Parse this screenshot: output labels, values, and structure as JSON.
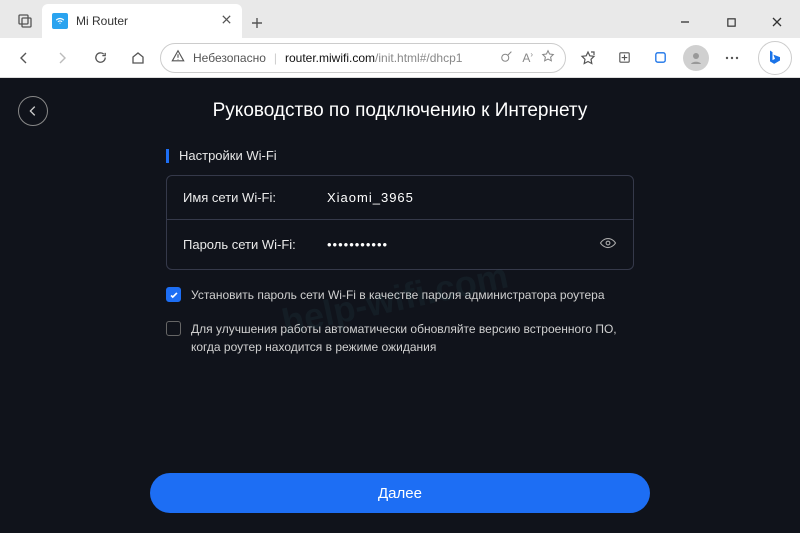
{
  "browser": {
    "tab_title": "Mi Router",
    "address": {
      "insecure_label": "Небезопасно",
      "host": "router.miwifi.com",
      "path": "/init.html#/dhcp1"
    }
  },
  "page": {
    "title": "Руководство по подключению к Интернету",
    "section_title": "Настройки Wi-Fi",
    "fields": {
      "ssid_label": "Имя сети Wi-Fi:",
      "ssid_value": "Xiaomi_3965",
      "password_label": "Пароль сети Wi-Fi:",
      "password_value": "•••••••••••"
    },
    "checkbox_admin": "Установить пароль сети Wi-Fi в качестве пароля администратора роутера",
    "checkbox_autoupdate": "Для улучшения работы автоматически обновляйте версию встроенного ПО, когда роутер находится в режиме ожидания",
    "button_next": "Далее"
  },
  "watermark": "help-wifi.com",
  "colors": {
    "accent": "#1d6ef4",
    "page_bg": "#10131b"
  }
}
